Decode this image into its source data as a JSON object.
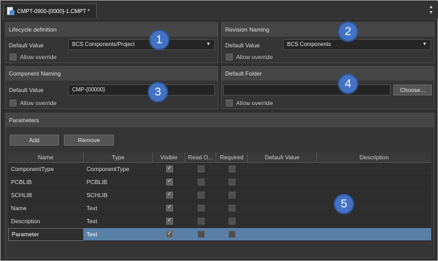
{
  "document": {
    "tab_title": "CMPT-0900-{0000}-1.CMPT *"
  },
  "lifecycle": {
    "header": "Lifecycle definition",
    "default_value_label": "Default Value",
    "default_value": "BCS Components/Project",
    "allow_override_label": "Allow override",
    "allow_override_checked": false
  },
  "revision": {
    "header": "Revision Naming",
    "default_value_label": "Default Value",
    "default_value": "BCS Components",
    "allow_override_label": "Allow override",
    "allow_override_checked": false
  },
  "component_naming": {
    "header": "Component Naming",
    "default_value_label": "Default Value",
    "default_value": "CMP-{00000}",
    "allow_override_label": "Allow override",
    "allow_override_checked": false
  },
  "default_folder": {
    "header": "Default Folder",
    "value": "",
    "choose_label": "Choose...",
    "allow_override_label": "Allow override",
    "allow_override_checked": false
  },
  "parameters": {
    "header": "Parameters",
    "add_label": "Add",
    "remove_label": "Remove",
    "columns": [
      "Name",
      "Type",
      "Visible",
      "Read O...",
      "Required",
      "Default Value",
      "Description"
    ],
    "rows": [
      {
        "name": "ComponentType",
        "type": "ComponentType",
        "visible": true,
        "read_only": false,
        "required": false,
        "default_value": "",
        "description": ""
      },
      {
        "name": "PCBLIB",
        "type": "PCBLIB",
        "visible": true,
        "read_only": false,
        "required": false,
        "default_value": "",
        "description": ""
      },
      {
        "name": "SCHLIB",
        "type": "SCHLIB",
        "visible": true,
        "read_only": false,
        "required": false,
        "default_value": "",
        "description": ""
      },
      {
        "name": "Name",
        "type": "Text",
        "visible": true,
        "read_only": false,
        "required": false,
        "default_value": "",
        "description": ""
      },
      {
        "name": "Description",
        "type": "Text",
        "visible": true,
        "read_only": false,
        "required": false,
        "default_value": "",
        "description": ""
      },
      {
        "name": "Parameter",
        "type": "Text",
        "visible": true,
        "read_only": false,
        "required": false,
        "default_value": "",
        "description": "",
        "selected": true
      }
    ]
  },
  "callouts": [
    "1",
    "2",
    "3",
    "4",
    "5"
  ],
  "icons": {
    "tab": "document-icon",
    "dropdown": "chevron-down-icon",
    "scroll": "scroll-arrows-icon"
  },
  "colors": {
    "background": "#2f2f2f",
    "panel_header": "#464646",
    "selection": "#5a80a8",
    "callout": "#4472c4"
  }
}
